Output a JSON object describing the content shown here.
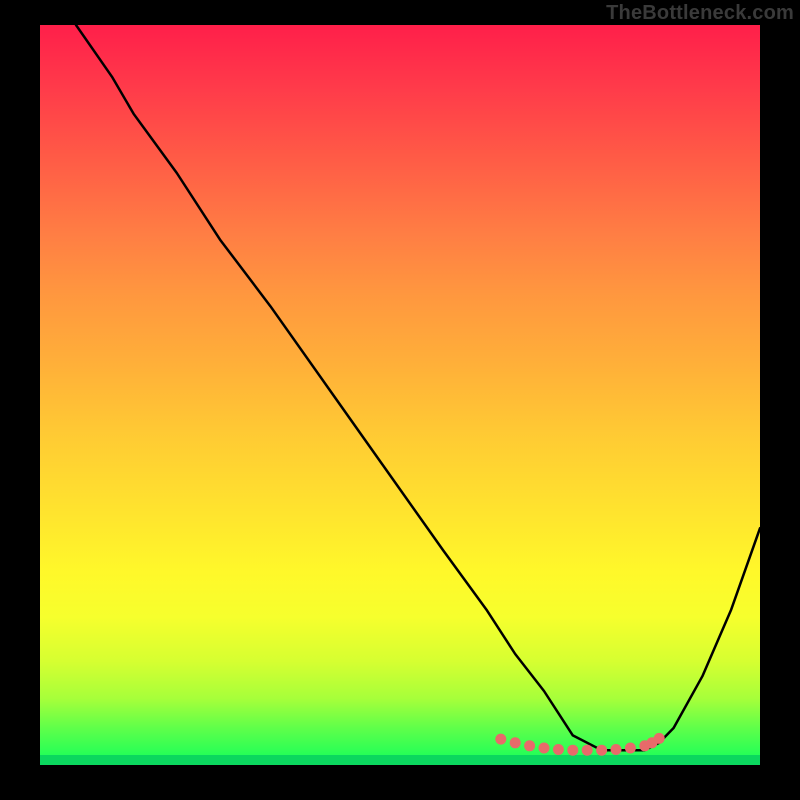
{
  "watermark": "TheBottleneck.com",
  "chart_data": {
    "type": "line",
    "title": "",
    "xlabel": "",
    "ylabel": "",
    "xlim": [
      0,
      100
    ],
    "ylim": [
      0,
      100
    ],
    "grid": false,
    "legend": null,
    "series": [
      {
        "name": "bottleneck-curve",
        "x": [
          5,
          10,
          13,
          19,
          25,
          32,
          40,
          48,
          56,
          62,
          66,
          70,
          72,
          74,
          78,
          82,
          84,
          86,
          88,
          92,
          96,
          100
        ],
        "y": [
          100,
          93,
          88,
          80,
          71,
          62,
          51,
          40,
          29,
          21,
          15,
          10,
          7,
          4,
          2,
          2,
          2,
          3,
          5,
          12,
          21,
          32
        ]
      }
    ],
    "annotations": {
      "trough_dots_x": [
        64,
        66,
        68,
        70,
        72,
        74,
        76,
        78,
        80,
        82,
        84,
        85,
        86
      ],
      "trough_dots_y": [
        3.5,
        3,
        2.6,
        2.3,
        2.1,
        2,
        2,
        2,
        2.1,
        2.3,
        2.6,
        3,
        3.6
      ]
    },
    "gradient_colors": {
      "top": "#ff1f4a",
      "mid_upper": "#ff963f",
      "mid": "#ffe42e",
      "mid_lower": "#a7ff3a",
      "bottom": "#11ff5b"
    }
  }
}
